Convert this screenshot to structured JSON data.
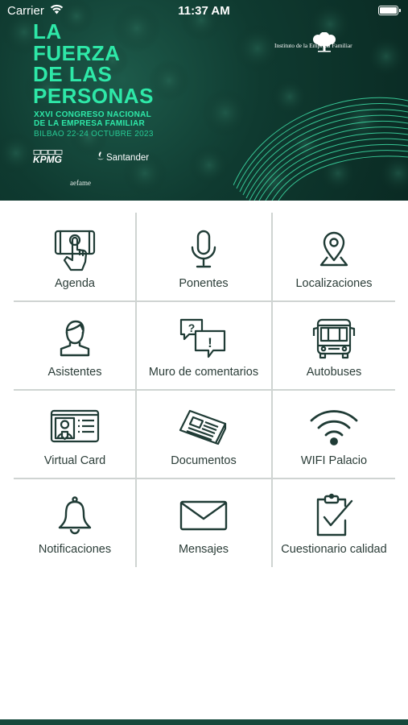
{
  "status_bar": {
    "carrier": "Carrier",
    "time": "11:37 AM"
  },
  "banner": {
    "headline": [
      "LA",
      "FUERZA",
      "DE LAS",
      "PERSONAS"
    ],
    "congress_lines": [
      "XXVI CONGRESO NACIONAL",
      "DE LA EMPRESA FAMILIAR"
    ],
    "dates": "BILBAO 22-24 OCTUBRE 2023",
    "sponsors": {
      "kpmg": "KPMG",
      "santander": "Santander",
      "aefame": "aefame"
    },
    "institute": "Instituto de la Empresa Familiar",
    "accent_color": "#2ee8a8",
    "background_color": "#0f3a30"
  },
  "menu": {
    "items": [
      {
        "label": "Agenda",
        "icon": "hand-touch-screen-icon"
      },
      {
        "label": "Ponentes",
        "icon": "microphone-icon"
      },
      {
        "label": "Localizaciones",
        "icon": "map-pin-icon"
      },
      {
        "label": "Asistentes",
        "icon": "person-icon"
      },
      {
        "label": "Muro de comentarios",
        "icon": "speech-bubbles-icon"
      },
      {
        "label": "Autobuses",
        "icon": "bus-icon"
      },
      {
        "label": "Virtual Card",
        "icon": "id-card-icon"
      },
      {
        "label": "Documentos",
        "icon": "newspaper-icon"
      },
      {
        "label": "WIFI Palacio",
        "icon": "wifi-icon"
      },
      {
        "label": "Notificaciones",
        "icon": "bell-icon"
      },
      {
        "label": "Mensajes",
        "icon": "envelope-icon"
      },
      {
        "label": "Cuestionario calidad",
        "icon": "clipboard-check-icon"
      }
    ],
    "icon_color": "#1f3b35",
    "divider_color": "#cfd4d2"
  },
  "bottom_bar_color": "#16493c"
}
